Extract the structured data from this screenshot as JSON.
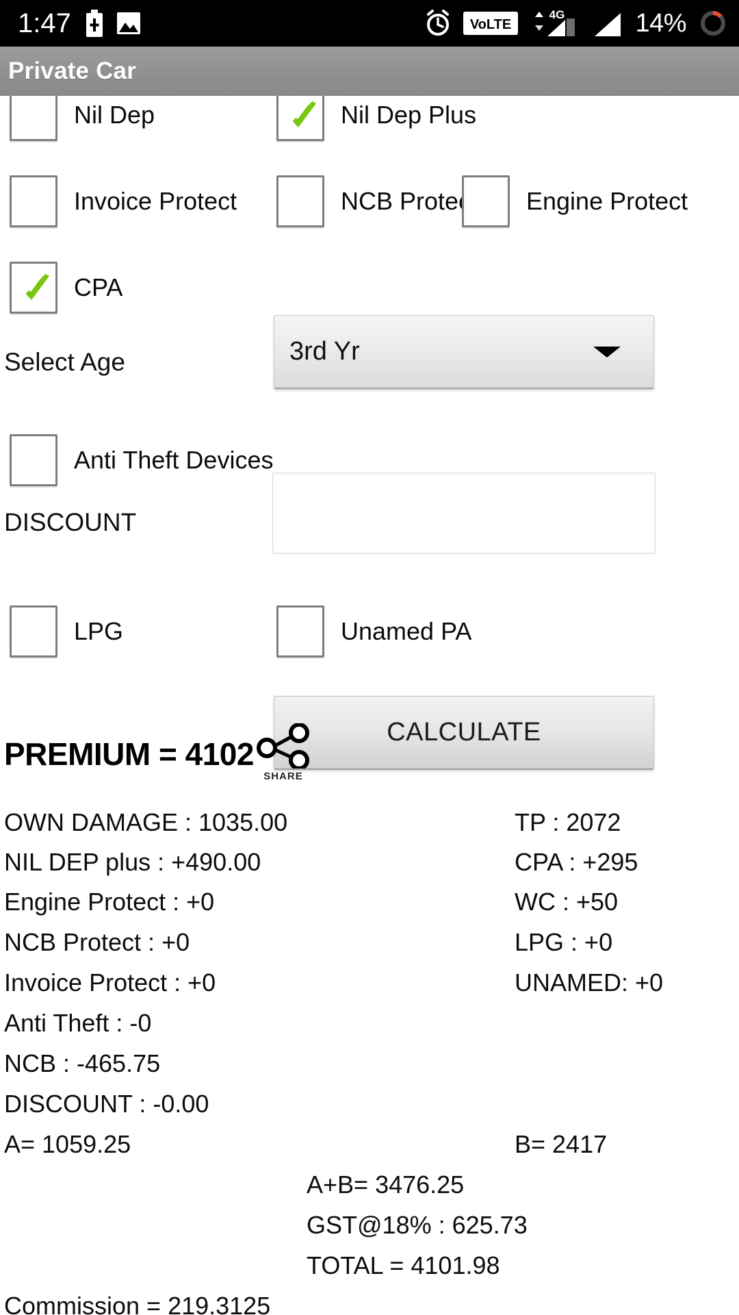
{
  "status_bar": {
    "time": "1:47",
    "battery_percent": "14%",
    "network_label": "4G",
    "volte_label": "VoLTE",
    "icons": [
      "battery-charging-icon",
      "image-icon",
      "alarm-icon",
      "volte-icon",
      "signal-4g-icon",
      "signal-bars-icon",
      "battery-ring-icon"
    ]
  },
  "action_bar": {
    "title": "Private Car"
  },
  "form": {
    "checkboxes_row1": [
      {
        "label": "Nil Dep",
        "checked": false
      },
      {
        "label": "Nil Dep Plus",
        "checked": true
      }
    ],
    "checkboxes_row2": [
      {
        "label": "Invoice Protect",
        "checked": false
      },
      {
        "label": "NCB Protect",
        "checked": false
      },
      {
        "label": "Engine Protect",
        "checked": false
      }
    ],
    "checkboxes_row3": [
      {
        "label": "CPA",
        "checked": true
      }
    ],
    "select_age": {
      "label": "Select Age",
      "value": "3rd Yr"
    },
    "anti_theft": {
      "label": "Anti Theft Devices",
      "checked": false
    },
    "discount": {
      "label": "DISCOUNT",
      "value": "",
      "placeholder": ""
    },
    "checkboxes_row4": [
      {
        "label": "LPG",
        "checked": false
      },
      {
        "label": "Unamed PA",
        "checked": false
      }
    ],
    "calculate_button": "CALCULATE"
  },
  "results": {
    "premium_heading": "PREMIUM = 4102",
    "share_label": "SHARE",
    "left_column": [
      "OWN DAMAGE : 1035.00",
      "NIL DEP plus : +490.00",
      "Engine Protect : +0",
      "NCB Protect : +0",
      "Invoice Protect : +0",
      "Anti Theft : -0",
      "NCB : -465.75",
      "DISCOUNT : -0.00"
    ],
    "right_column": [
      "TP : 2072",
      "CPA : +295",
      "WC : +50",
      "LPG : +0",
      "UNAMED: +0"
    ],
    "subtotal_a": "A= 1059.25",
    "subtotal_b": "B= 2417",
    "a_plus_b": "A+B= 3476.25",
    "gst": "GST@18% : 625.73",
    "total": "TOTAL =  4101.98",
    "commission": "Commission = 219.3125"
  }
}
